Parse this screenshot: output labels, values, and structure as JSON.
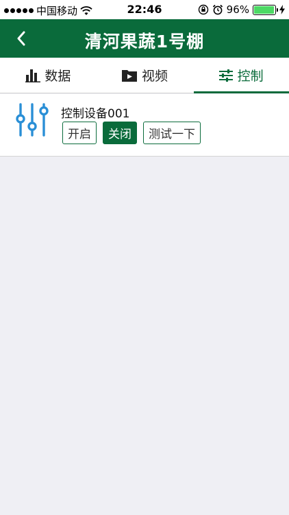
{
  "status_bar": {
    "carrier": "中国移动",
    "time": "22:46",
    "battery": "96%",
    "battery_level": 0.96
  },
  "nav": {
    "title": "清河果蔬1号棚",
    "back_icon": "chevron-left-icon"
  },
  "tabs": [
    {
      "label": "数据",
      "icon": "bar-chart-icon",
      "active": false
    },
    {
      "label": "视频",
      "icon": "video-folder-icon",
      "active": false
    },
    {
      "label": "控制",
      "icon": "sliders-icon",
      "active": true
    }
  ],
  "device": {
    "name": "控制设备001",
    "icon": "equalizer-icon",
    "buttons": [
      {
        "label": "开启",
        "active": false
      },
      {
        "label": "关闭",
        "active": true
      },
      {
        "label": "测试一下",
        "active": false
      }
    ]
  },
  "colors": {
    "brand": "#0a6b3b",
    "icon_blue": "#2a8fd6",
    "background": "#efeff4"
  }
}
